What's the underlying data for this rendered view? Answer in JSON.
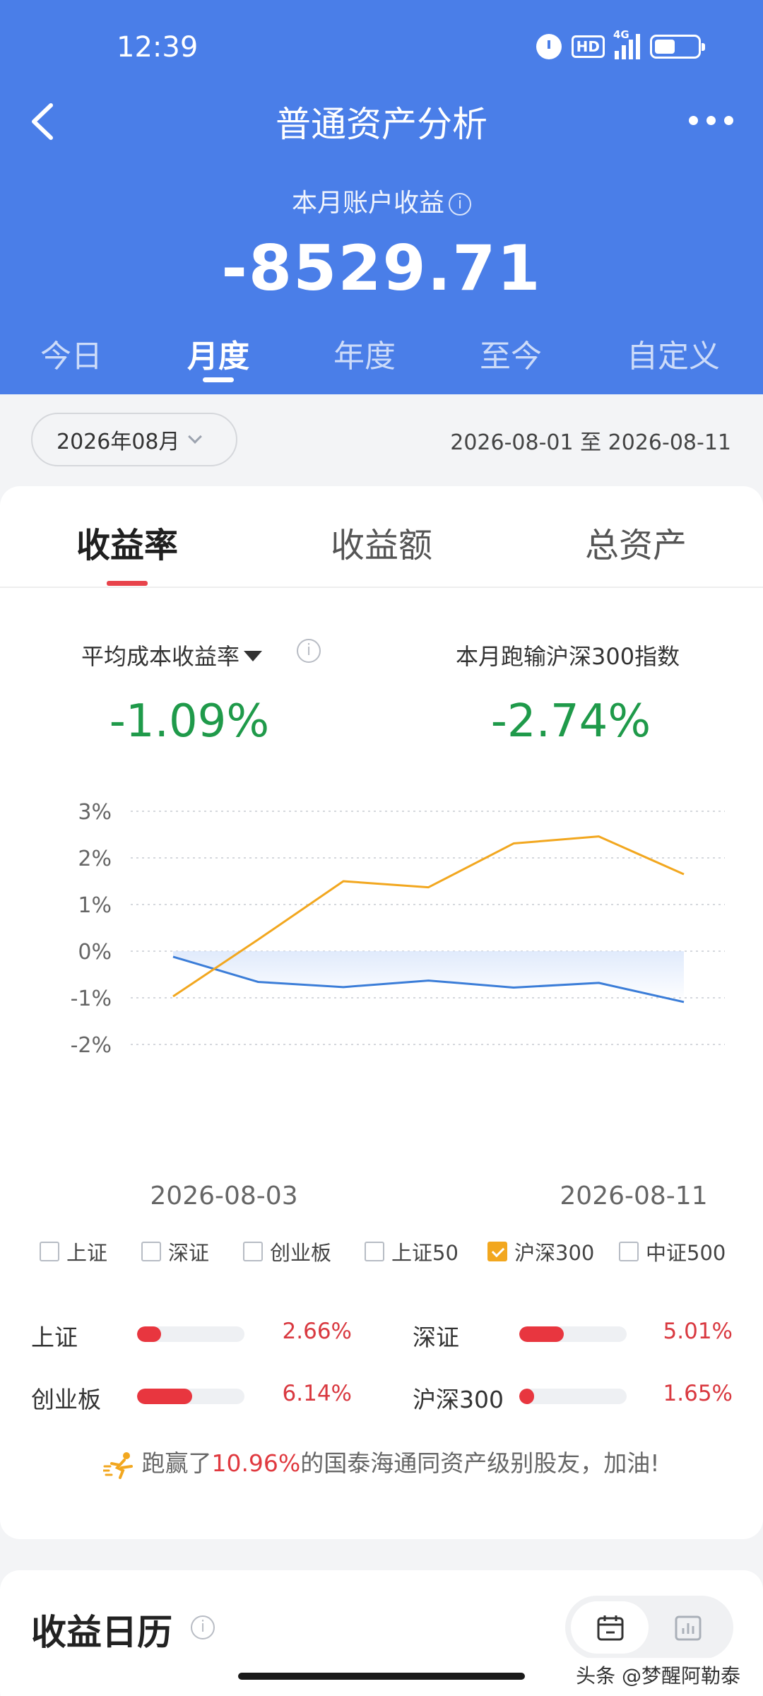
{
  "status_bar": {
    "time": "12:39",
    "hd_label": "HD",
    "network_label": "4G"
  },
  "header": {
    "title": "普通资产分析",
    "subtitle": "本月账户收益",
    "amount": "-8529.71",
    "info_glyph": "i",
    "period_tabs": [
      {
        "label": "今日",
        "active": false
      },
      {
        "label": "月度",
        "active": true
      },
      {
        "label": "年度",
        "active": false
      },
      {
        "label": "至今",
        "active": false
      },
      {
        "label": "自定义",
        "active": false
      }
    ]
  },
  "filter": {
    "month": "2026年08月",
    "date_range": "2026-08-01 至 2026-08-11"
  },
  "metric_tabs": [
    {
      "label": "收益率",
      "active": true
    },
    {
      "label": "收益额",
      "active": false
    },
    {
      "label": "总资产",
      "active": false
    }
  ],
  "stats": {
    "left_label": "平均成本收益率",
    "left_value": "-1.09%",
    "right_label": "本月跑输沪深300指数",
    "right_value": "-2.74%"
  },
  "chart_data": {
    "type": "line",
    "x": [
      "2026-08-03",
      "2026-08-04",
      "2026-08-05",
      "2026-08-06",
      "2026-08-07",
      "2026-08-10",
      "2026-08-11"
    ],
    "x_tick_labels": [
      "2026-08-03",
      "2026-08-11"
    ],
    "y_tick_labels": [
      "3%",
      "2%",
      "1%",
      "0%",
      "-1%",
      "-2%"
    ],
    "ylim": [
      -2,
      3
    ],
    "grid": true,
    "series": [
      {
        "key": "account",
        "color": "#3b7dd8",
        "values": [
          -0.12,
          -0.66,
          -0.77,
          -0.63,
          -0.78,
          -0.68,
          -1.09
        ]
      },
      {
        "key": "hs300",
        "color": "#f2a71f",
        "values": [
          -0.97,
          0.25,
          1.5,
          1.37,
          2.31,
          2.46,
          1.65
        ]
      }
    ]
  },
  "legend": [
    {
      "label": "上证",
      "checked": false
    },
    {
      "label": "深证",
      "checked": false
    },
    {
      "label": "创业板",
      "checked": false
    },
    {
      "label": "上证50",
      "checked": false
    },
    {
      "label": "沪深300",
      "checked": true
    },
    {
      "label": "中证500",
      "checked": false
    }
  ],
  "indices": [
    {
      "name": "上证",
      "value": "2.66%",
      "pct": 2.66
    },
    {
      "name": "深证",
      "value": "5.01%",
      "pct": 5.01
    },
    {
      "name": "创业板",
      "value": "6.14%",
      "pct": 6.14
    },
    {
      "name": "沪深300",
      "value": "1.65%",
      "pct": 1.65
    }
  ],
  "beat": {
    "prefix": "跑赢了",
    "pct": "10.96%",
    "suffix": "的国泰海通同资产级别股友，加油!"
  },
  "calendar": {
    "title": "收益日历"
  },
  "watermark": "头条 @梦醒阿勒泰",
  "colors": {
    "header_bg": "#4a7ee8",
    "gain_green": "#1f9a4a",
    "loss_red": "#e8363f",
    "hs300_orange": "#f2a71f",
    "account_blue": "#3b7dd8"
  }
}
